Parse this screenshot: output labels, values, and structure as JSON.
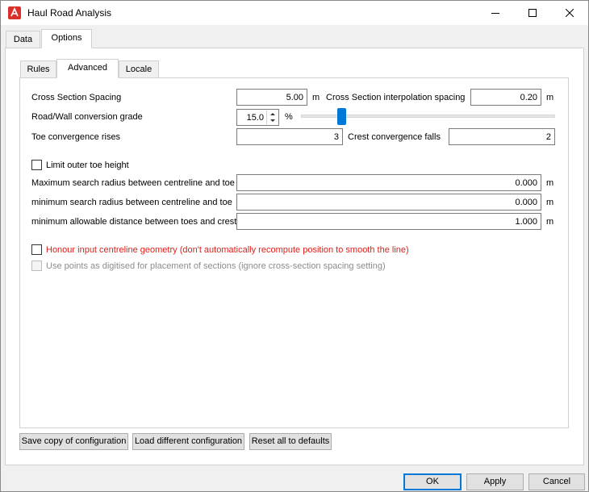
{
  "window": {
    "title": "Haul Road Analysis"
  },
  "outer_tabs": [
    {
      "label": "Data"
    },
    {
      "label": "Options"
    }
  ],
  "inner_tabs": [
    {
      "label": "Rules"
    },
    {
      "label": "Advanced"
    },
    {
      "label": "Locale"
    }
  ],
  "fields": {
    "cross_section_spacing": {
      "label": "Cross Section Spacing",
      "value": "5.00",
      "unit": "m"
    },
    "interp_spacing": {
      "label": "Cross Section interpolation spacing",
      "value": "0.20",
      "unit": "m"
    },
    "conversion_grade": {
      "label": "Road/Wall conversion grade",
      "value": "15.0",
      "unit": "%"
    },
    "toe_rises": {
      "label": "Toe convergence rises",
      "value": "3"
    },
    "crest_falls": {
      "label": "Crest convergence falls",
      "value": "2"
    },
    "limit_toe": {
      "label": "Limit outer toe height"
    },
    "max_radius": {
      "label": "Maximum search radius between centreline and toe",
      "value": "0.000",
      "unit": "m"
    },
    "min_radius": {
      "label": "minimum search radius between centreline and toe",
      "value": "0.000",
      "unit": "m"
    },
    "min_distance": {
      "label": "minimum allowable distance between toes and crest",
      "value": "1.000",
      "unit": "m"
    },
    "honour_geometry": {
      "label": "Honour input centreline geometry (don't automatically recompute position to smooth the line)"
    },
    "use_points": {
      "label": "Use points as digitised for placement of sections (ignore cross-section spacing setting)"
    }
  },
  "config_buttons": {
    "save": "Save copy of configuration",
    "load": "Load different configuration",
    "reset": "Reset all to defaults"
  },
  "dialog_buttons": {
    "ok": "OK",
    "apply": "Apply",
    "cancel": "Cancel"
  },
  "colors": {
    "accent": "#0078d7",
    "warning_text": "#e0201b",
    "disabled_text": "#8c8c8c"
  }
}
